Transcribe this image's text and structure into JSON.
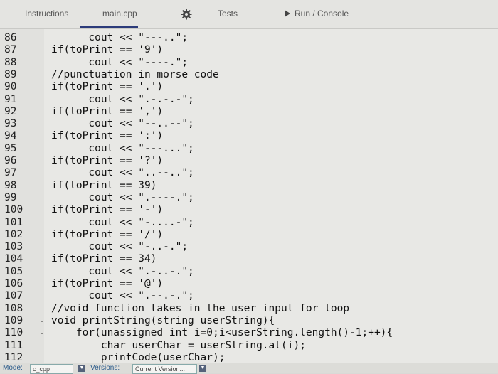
{
  "tabs": {
    "instructions": "Instructions",
    "main_file": "main.cpp",
    "settings_icon": "gear-icon",
    "tests": "Tests",
    "run": "Run / Console"
  },
  "editor": {
    "lines": [
      {
        "num": "86",
        "fold": "",
        "code": "      cout << \"---..\";"
      },
      {
        "num": "87",
        "fold": "",
        "code": "if(toPrint == '9')"
      },
      {
        "num": "88",
        "fold": "",
        "code": "      cout << \"----.\";"
      },
      {
        "num": "89",
        "fold": "",
        "code": "//punctuation in morse code"
      },
      {
        "num": "90",
        "fold": "",
        "code": "if(toPrint == '.')"
      },
      {
        "num": "91",
        "fold": "",
        "code": "      cout << \".-.-.-\";"
      },
      {
        "num": "92",
        "fold": "",
        "code": "if(toPrint == ',')"
      },
      {
        "num": "93",
        "fold": "",
        "code": "      cout << \"--..--\";"
      },
      {
        "num": "94",
        "fold": "",
        "code": "if(toPrint == ':')"
      },
      {
        "num": "95",
        "fold": "",
        "code": "      cout << \"---...\";"
      },
      {
        "num": "96",
        "fold": "",
        "code": "if(toPrint == '?')"
      },
      {
        "num": "97",
        "fold": "",
        "code": "      cout << \"..--..\";"
      },
      {
        "num": "98",
        "fold": "",
        "code": "if(toPrint == 39)"
      },
      {
        "num": "99",
        "fold": "",
        "code": "      cout << \".----.\";"
      },
      {
        "num": "100",
        "fold": "",
        "code": "if(toPrint == '-')"
      },
      {
        "num": "101",
        "fold": "",
        "code": "      cout << \"-....-\";"
      },
      {
        "num": "102",
        "fold": "",
        "code": "if(toPrint == '/')"
      },
      {
        "num": "103",
        "fold": "",
        "code": "      cout << \"-..-.\";"
      },
      {
        "num": "104",
        "fold": "",
        "code": "if(toPrint == 34)"
      },
      {
        "num": "105",
        "fold": "",
        "code": "      cout << \".-..-.\";"
      },
      {
        "num": "106",
        "fold": "",
        "code": "if(toPrint == '@')"
      },
      {
        "num": "107",
        "fold": "",
        "code": "      cout << \".--.-.\";"
      },
      {
        "num": "108",
        "fold": "",
        "code": "//void function takes in the user input for loop"
      },
      {
        "num": "109",
        "fold": "-",
        "code": "void printString(string userString){"
      },
      {
        "num": "110",
        "fold": "-",
        "code": "    for(unassigned int i=0;i<userString.length()-1;++){"
      },
      {
        "num": "111",
        "fold": "",
        "code": "        char userChar = userString.at(i);"
      },
      {
        "num": "112",
        "fold": "",
        "code": "        printCode(userChar);"
      }
    ]
  },
  "statusbar": {
    "mode_label": "Mode:",
    "mode_value": "c_cpp",
    "versions_label": "Versions:",
    "versions_value": "Current Version..."
  }
}
